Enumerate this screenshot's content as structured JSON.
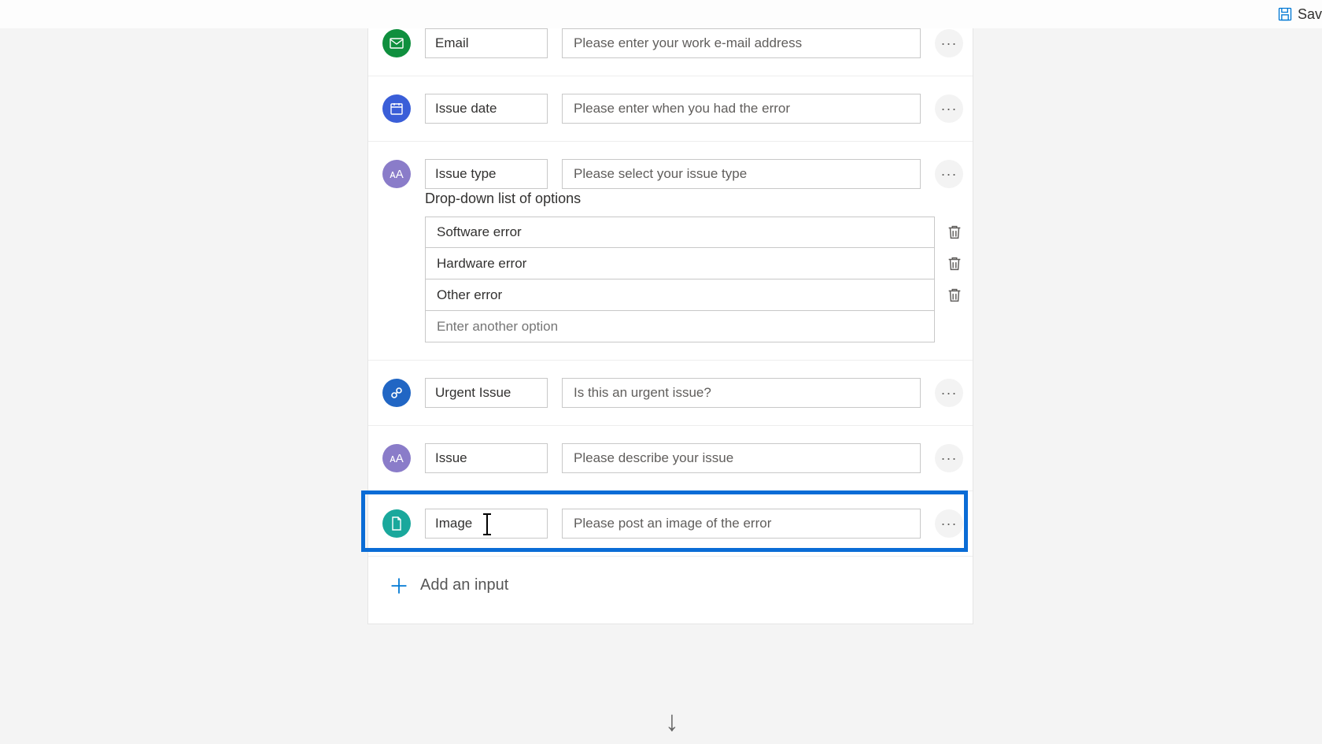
{
  "toolbar": {
    "save_label": "Sav"
  },
  "rows": {
    "email": {
      "name": "Email",
      "desc": "Please enter your work e-mail address"
    },
    "date": {
      "name": "Issue date",
      "desc": "Please enter when you had the error"
    },
    "type": {
      "name": "Issue type",
      "desc": "Please select your issue type"
    },
    "urgent": {
      "name": "Urgent Issue",
      "desc": "Is this an urgent issue?"
    },
    "issue": {
      "name": "Issue",
      "desc": "Please describe your issue"
    },
    "image": {
      "name": "Image",
      "desc": "Please post an image of the error"
    }
  },
  "dropdown": {
    "label": "Drop-down list of options",
    "options": [
      "Software error",
      "Hardware error",
      "Other error"
    ],
    "placeholder": "Enter another option"
  },
  "add_input_label": "Add an input",
  "icons": {
    "email": "mail-icon",
    "date": "calendar-icon",
    "type": "text-icon",
    "urgent": "link-icon",
    "issue": "text-icon",
    "image": "document-icon"
  }
}
